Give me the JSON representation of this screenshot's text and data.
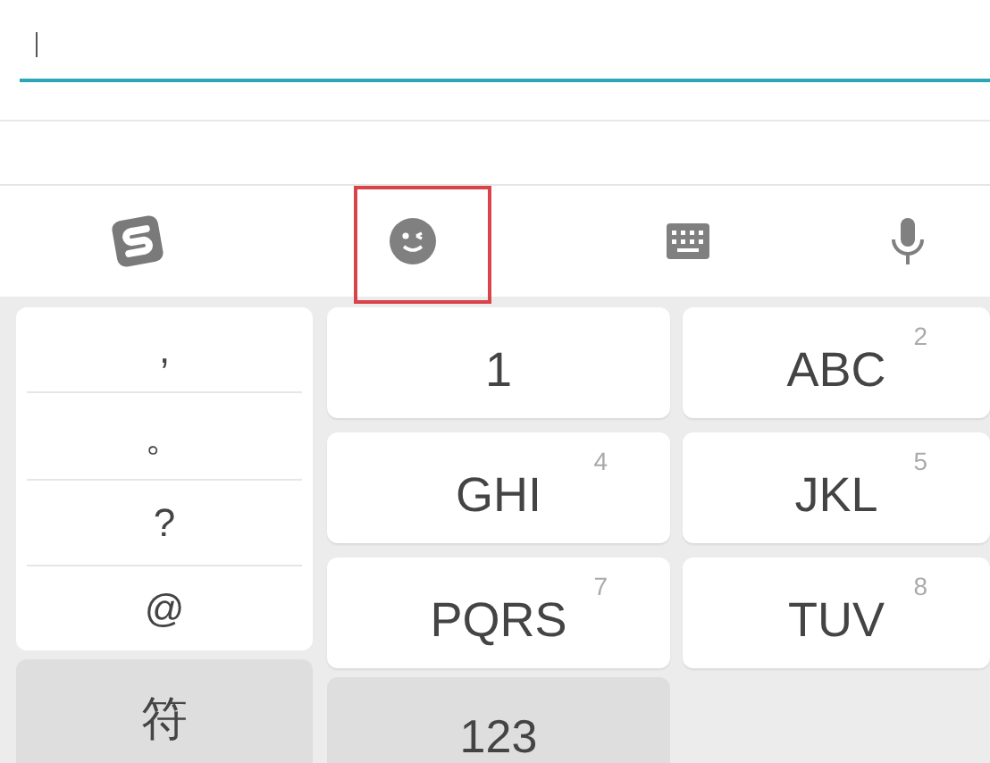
{
  "text_field": {
    "focused": true
  },
  "toolbar": [
    {
      "kind": "logo",
      "highlighted": false
    },
    {
      "kind": "emoji",
      "highlighted": true
    },
    {
      "kind": "keyboard",
      "highlighted": false
    },
    {
      "kind": "mic",
      "highlighted": false
    }
  ],
  "punctuation": [
    ",",
    "。",
    "?",
    "@"
  ],
  "keys": [
    {
      "label": "1"
    },
    {
      "label": "ABC",
      "digit": "2"
    },
    {
      "label": "GHI",
      "digit": "4"
    },
    {
      "label": "JKL",
      "digit": "5"
    },
    {
      "label": "PQRS",
      "digit": "7"
    },
    {
      "label": "TUV",
      "digit": "8"
    }
  ],
  "bottom_keys": [
    "符",
    "123"
  ]
}
